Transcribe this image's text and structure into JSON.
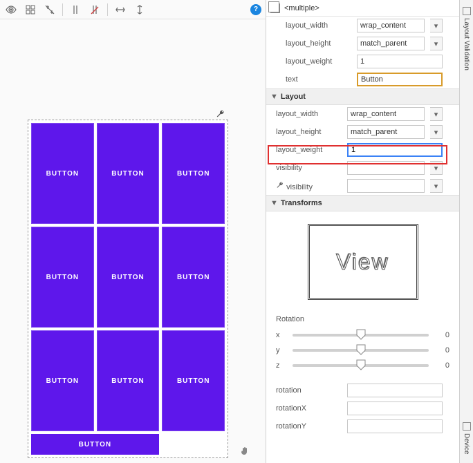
{
  "selection": "<multiple>",
  "declared": {
    "layout_width": "wrap_content",
    "layout_height": "match_parent",
    "layout_weight": "1",
    "text": "Button"
  },
  "sections": {
    "layout": "Layout",
    "transforms": "Transforms"
  },
  "layout": {
    "layout_width": "wrap_content",
    "layout_height": "match_parent",
    "layout_weight": "1",
    "visibility": "",
    "tools_visibility": ""
  },
  "labels": {
    "layout_width": "layout_width",
    "layout_height": "layout_height",
    "layout_weight": "layout_weight",
    "text": "text",
    "visibility": "visibility",
    "tools_visibility": "visibility",
    "rotation": "rotation",
    "rotationX": "rotationX",
    "rotationY": "rotationY"
  },
  "transforms": {
    "preview": "View",
    "rotation_title": "Rotation",
    "axes": [
      {
        "label": "x",
        "value": "0"
      },
      {
        "label": "y",
        "value": "0"
      },
      {
        "label": "z",
        "value": "0"
      }
    ],
    "rotation_fields": {
      "rotation": "",
      "rotationX": "",
      "rotationY": ""
    }
  },
  "canvas": {
    "button_label": "BUTTON"
  },
  "sidetabs": {
    "validation": "Layout Validation",
    "device": "Device"
  }
}
